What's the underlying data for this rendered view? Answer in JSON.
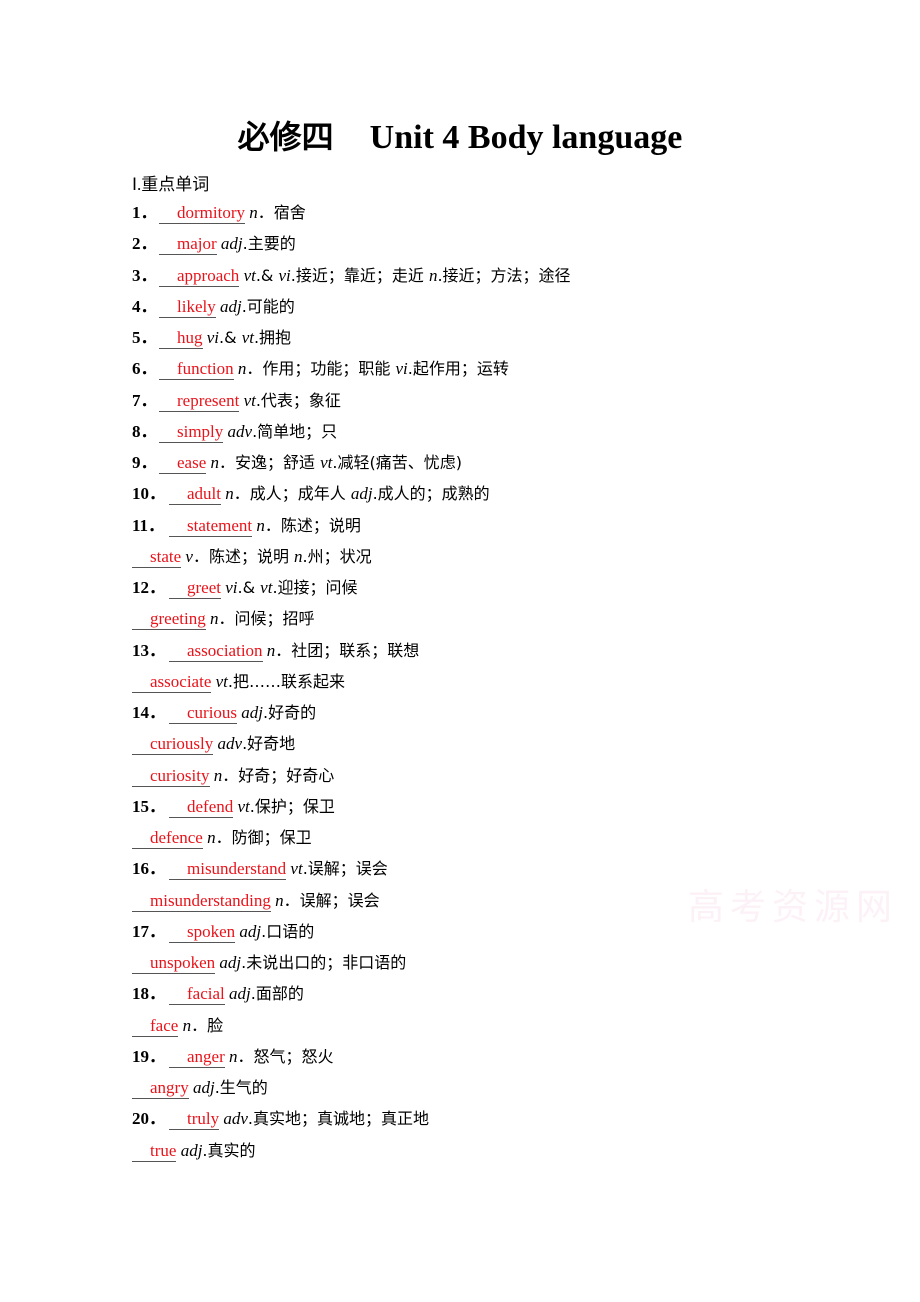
{
  "title": {
    "cn": "必修四",
    "en": "Unit 4 Body language"
  },
  "section": {
    "roman": "Ⅰ.",
    "label": "重点单词"
  },
  "watermark": "高考资源网",
  "colors": {
    "answer": "#e8141b",
    "text": "#000000"
  },
  "entries": [
    {
      "num": "1．",
      "word": "dormitory",
      "def": [
        [
          "pos",
          "n"
        ],
        [
          "cn",
          "．宿舍"
        ]
      ]
    },
    {
      "num": "2．",
      "word": "major",
      "def": [
        [
          "pos",
          "adj"
        ],
        [
          "cn",
          ".主要的"
        ]
      ]
    },
    {
      "num": "3．",
      "word": "approach",
      "def": [
        [
          "pos",
          "vt"
        ],
        [
          "cn",
          ".& "
        ],
        [
          "pos",
          "vi"
        ],
        [
          "cn",
          ".接近；靠近；走近 "
        ],
        [
          "pos",
          "n"
        ],
        [
          "cn",
          ".接近；方法；途径"
        ]
      ]
    },
    {
      "num": "4．",
      "word": "likely",
      "def": [
        [
          "pos",
          "adj"
        ],
        [
          "cn",
          ".可能的"
        ]
      ]
    },
    {
      "num": "5．",
      "word": "hug",
      "def": [
        [
          "pos",
          "vi"
        ],
        [
          "cn",
          ".& "
        ],
        [
          "pos",
          "vt"
        ],
        [
          "cn",
          ".拥抱"
        ]
      ]
    },
    {
      "num": "6．",
      "word": "function",
      "def": [
        [
          "pos",
          "n"
        ],
        [
          "cn",
          "．作用；功能；职能 "
        ],
        [
          "pos",
          "vi"
        ],
        [
          "cn",
          ".起作用；运转"
        ]
      ]
    },
    {
      "num": "7．",
      "word": "represent",
      "def": [
        [
          "pos",
          "vt"
        ],
        [
          "cn",
          ".代表；象征"
        ]
      ]
    },
    {
      "num": "8．",
      "word": "simply",
      "def": [
        [
          "pos",
          "adv"
        ],
        [
          "cn",
          ".简单地；只"
        ]
      ]
    },
    {
      "num": "9．",
      "word": "ease",
      "def": [
        [
          "pos",
          "n"
        ],
        [
          "cn",
          "．安逸；舒适  "
        ],
        [
          "pos",
          "vt"
        ],
        [
          "cn",
          ".减轻(痛苦、忧虑)"
        ]
      ]
    },
    {
      "num": "10．",
      "word": "adult",
      "def": [
        [
          "pos",
          "n"
        ],
        [
          "cn",
          "．成人；成年人  "
        ],
        [
          "pos",
          "adj"
        ],
        [
          "cn",
          ".成人的；成熟的"
        ]
      ]
    },
    {
      "num": "11．",
      "word": "statement",
      "def": [
        [
          "pos",
          "n"
        ],
        [
          "cn",
          "．陈述；说明"
        ]
      ]
    },
    {
      "num": "",
      "word": "state",
      "def": [
        [
          "pos",
          "v"
        ],
        [
          "cn",
          "．陈述；说明 "
        ],
        [
          "pos",
          "n"
        ],
        [
          "cn",
          ".州；状况"
        ]
      ]
    },
    {
      "num": "12．",
      "word": "greet",
      "def": [
        [
          "pos",
          "vi"
        ],
        [
          "cn",
          ".& "
        ],
        [
          "pos",
          "vt"
        ],
        [
          "cn",
          ".迎接；问候"
        ]
      ]
    },
    {
      "num": "",
      "word": "greeting",
      "def": [
        [
          "pos",
          "n"
        ],
        [
          "cn",
          "．问候；招呼"
        ]
      ]
    },
    {
      "num": "13．",
      "word": "association",
      "def": [
        [
          "pos",
          "n"
        ],
        [
          "cn",
          "．社团；联系；联想"
        ]
      ]
    },
    {
      "num": "",
      "word": "associate",
      "def": [
        [
          "pos",
          "vt"
        ],
        [
          "cn",
          ".把……联系起来"
        ]
      ]
    },
    {
      "num": "14．",
      "word": "curious",
      "def": [
        [
          "pos",
          "adj"
        ],
        [
          "cn",
          ".好奇的"
        ]
      ]
    },
    {
      "num": "",
      "word": "curiously",
      "def": [
        [
          "pos",
          "adv"
        ],
        [
          "cn",
          ".好奇地"
        ]
      ]
    },
    {
      "num": "",
      "word": "curiosity",
      "def": [
        [
          "pos",
          "n"
        ],
        [
          "cn",
          "．好奇；好奇心"
        ]
      ]
    },
    {
      "num": "15．",
      "word": "defend",
      "def": [
        [
          "pos",
          "vt"
        ],
        [
          "cn",
          ".保护；保卫"
        ]
      ]
    },
    {
      "num": "",
      "word": "defence",
      "def": [
        [
          "pos",
          "n"
        ],
        [
          "cn",
          "．防御；保卫"
        ]
      ]
    },
    {
      "num": "16．",
      "word": "misunderstand",
      "def": [
        [
          "pos",
          "vt"
        ],
        [
          "cn",
          ".误解；误会"
        ]
      ]
    },
    {
      "num": "",
      "word": "misunderstanding",
      "def": [
        [
          "pos",
          "n"
        ],
        [
          "cn",
          "．误解；误会"
        ]
      ]
    },
    {
      "num": "17．",
      "word": "spoken",
      "def": [
        [
          "pos",
          "adj"
        ],
        [
          "cn",
          ".口语的"
        ]
      ]
    },
    {
      "num": "",
      "word": "unspoken",
      "def": [
        [
          "pos",
          "adj"
        ],
        [
          "cn",
          ".未说出口的；非口语的"
        ]
      ]
    },
    {
      "num": "18．",
      "word": "facial",
      "def": [
        [
          "pos",
          "adj"
        ],
        [
          "cn",
          ".面部的"
        ]
      ]
    },
    {
      "num": "",
      "word": "face",
      "def": [
        [
          "pos",
          "n"
        ],
        [
          "cn",
          "．脸"
        ]
      ]
    },
    {
      "num": "19．",
      "word": "anger",
      "def": [
        [
          "pos",
          "n"
        ],
        [
          "cn",
          "．怒气；怒火"
        ]
      ]
    },
    {
      "num": "",
      "word": "angry",
      "def": [
        [
          "pos",
          "adj"
        ],
        [
          "cn",
          ".生气的"
        ]
      ]
    },
    {
      "num": "20．",
      "word": "truly",
      "def": [
        [
          "pos",
          "adv"
        ],
        [
          "cn",
          ".真实地；真诚地；真正地"
        ]
      ]
    },
    {
      "num": "",
      "word": "true",
      "def": [
        [
          "pos",
          "adj"
        ],
        [
          "cn",
          ".真实的"
        ]
      ]
    }
  ]
}
